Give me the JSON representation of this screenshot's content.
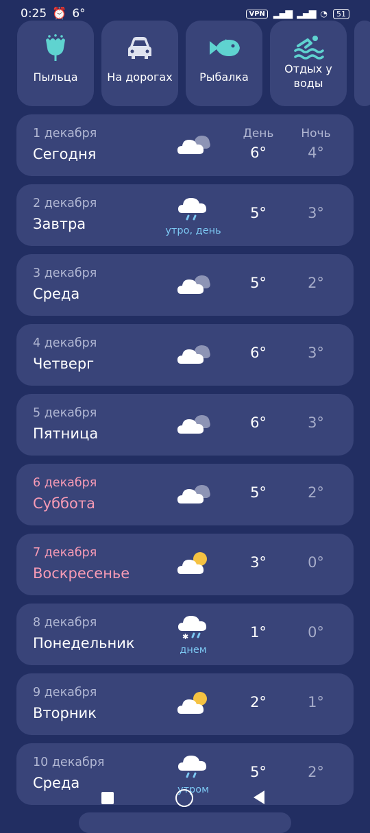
{
  "status_bar": {
    "time": "0:25",
    "temp": "6°",
    "vpn": "VPN",
    "battery": "51"
  },
  "tiles": [
    {
      "label": "Пыльца",
      "icon": "flower-icon"
    },
    {
      "label": "На дорогах",
      "icon": "car-icon"
    },
    {
      "label": "Рыбалка",
      "icon": "fish-icon"
    },
    {
      "label": "Отдых у воды",
      "icon": "swimming-icon"
    }
  ],
  "headers": {
    "day": "День",
    "night": "Ночь"
  },
  "days": [
    {
      "date": "1 декабря",
      "name": "Сегодня",
      "icon": "cloudy-icon",
      "precip": "",
      "day_temp": "6°",
      "night_temp": "4°",
      "weekend": false
    },
    {
      "date": "2 декабря",
      "name": "Завтра",
      "icon": "rain-icon",
      "precip": "утро, день",
      "day_temp": "5°",
      "night_temp": "3°",
      "weekend": false
    },
    {
      "date": "3 декабря",
      "name": "Среда",
      "icon": "cloudy-icon",
      "precip": "",
      "day_temp": "5°",
      "night_temp": "2°",
      "weekend": false
    },
    {
      "date": "4 декабря",
      "name": "Четверг",
      "icon": "cloudy-icon",
      "precip": "",
      "day_temp": "6°",
      "night_temp": "3°",
      "weekend": false
    },
    {
      "date": "5 декабря",
      "name": "Пятница",
      "icon": "cloudy-icon",
      "precip": "",
      "day_temp": "6°",
      "night_temp": "3°",
      "weekend": false
    },
    {
      "date": "6 декабря",
      "name": "Суббота",
      "icon": "cloudy-icon",
      "precip": "",
      "day_temp": "5°",
      "night_temp": "2°",
      "weekend": true
    },
    {
      "date": "7 декабря",
      "name": "Воскресенье",
      "icon": "partly-sunny-icon",
      "precip": "",
      "day_temp": "3°",
      "night_temp": "0°",
      "weekend": true
    },
    {
      "date": "8 декабря",
      "name": "Понедельник",
      "icon": "snow-rain-icon",
      "precip": "днем",
      "day_temp": "1°",
      "night_temp": "0°",
      "weekend": false
    },
    {
      "date": "9 декабря",
      "name": "Вторник",
      "icon": "partly-sunny-icon",
      "precip": "",
      "day_temp": "2°",
      "night_temp": "1°",
      "weekend": false
    },
    {
      "date": "10 декабря",
      "name": "Среда",
      "icon": "rain-icon",
      "precip": "утром",
      "day_temp": "5°",
      "night_temp": "2°",
      "weekend": false
    }
  ],
  "colors": {
    "background": "#222e62",
    "card": "#394479",
    "accent_teal": "#5fd3d0",
    "weekend": "#f79bb5",
    "precip": "#7cc7f2",
    "sun": "#f5c242"
  }
}
